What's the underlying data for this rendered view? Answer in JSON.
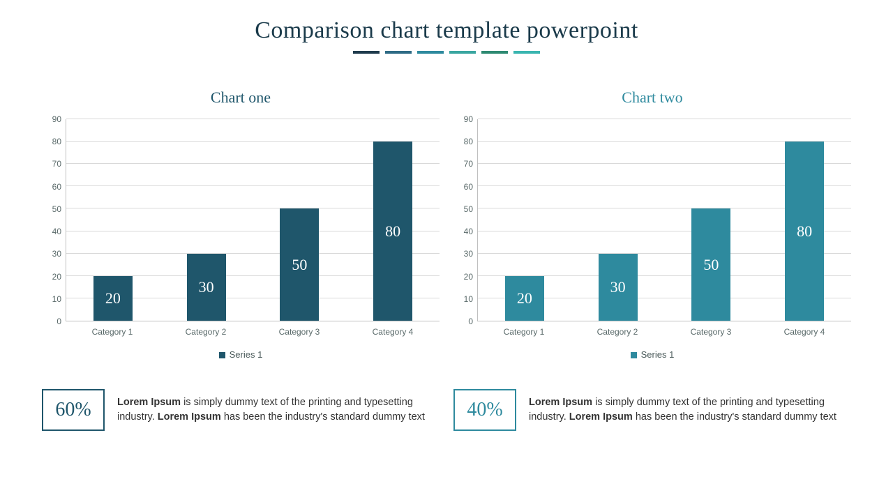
{
  "title": "Comparison chart template powerpoint",
  "divider_colors": [
    "#1f3b4d",
    "#2e6b85",
    "#2e8a9e",
    "#3aa6a0",
    "#2e8a72",
    "#3ab5b0"
  ],
  "chart_data": [
    {
      "type": "bar",
      "title": "Chart one",
      "title_color": "#1f566b",
      "bar_color": "#1f566b",
      "categories": [
        "Category 1",
        "Category 2",
        "Category 3",
        "Category 4"
      ],
      "values": [
        20,
        30,
        50,
        80
      ],
      "ylim": [
        0,
        90
      ],
      "ytick_step": 10,
      "legend": "Series 1"
    },
    {
      "type": "bar",
      "title": "Chart two",
      "title_color": "#2e8a9e",
      "bar_color": "#2e8a9e",
      "categories": [
        "Category 1",
        "Category 2",
        "Category 3",
        "Category 4"
      ],
      "values": [
        20,
        30,
        50,
        80
      ],
      "ylim": [
        0,
        90
      ],
      "ytick_step": 10,
      "legend": "Series 1"
    }
  ],
  "stats": [
    {
      "value": "60%",
      "color": "#1f566b",
      "bold1": "Lorem Ipsum",
      "text1": " is simply dummy text of the printing and typesetting industry. ",
      "bold2": "Lorem Ipsum",
      "text2": " has been the industry's standard dummy text"
    },
    {
      "value": "40%",
      "color": "#2e8a9e",
      "bold1": "Lorem Ipsum",
      "text1": " is simply dummy text of the printing and typesetting industry. ",
      "bold2": "Lorem Ipsum",
      "text2": " has been the industry's standard dummy text"
    }
  ]
}
